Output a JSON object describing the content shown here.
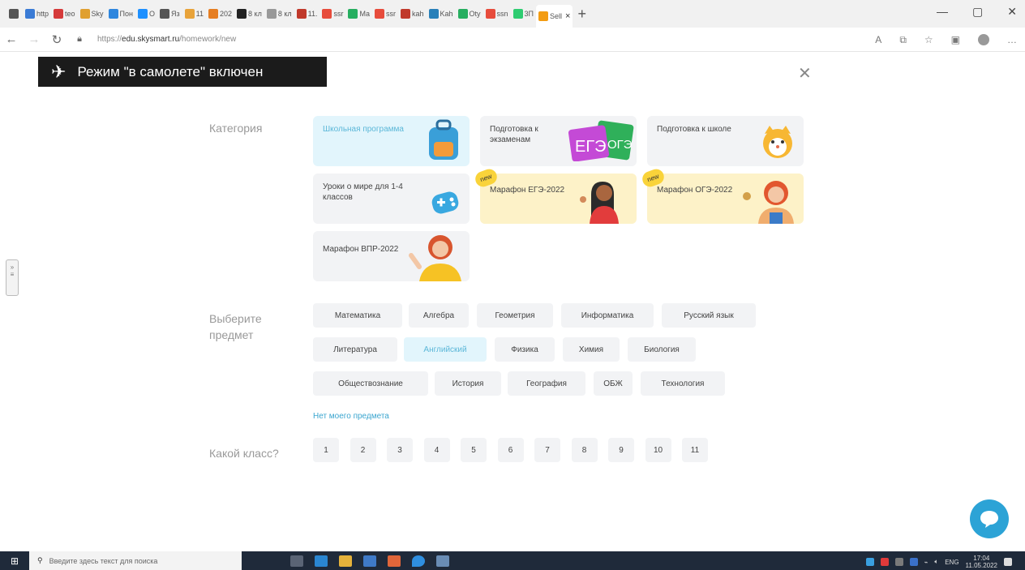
{
  "browser": {
    "tabs": [
      "http",
      "teo",
      "Sky",
      "Пон",
      "О",
      "Яз",
      "11",
      "202",
      "8 кл",
      "8 кл",
      "11.",
      "ssr",
      "Ma",
      "ssr",
      "kah",
      "Kah",
      "Oty",
      "ssn",
      "3П",
      "Sell"
    ],
    "url_prefix": "https://",
    "url_domain": "edu.skysmart.ru",
    "url_path": "/homework/new"
  },
  "toast": {
    "text": "Режим \"в самолете\" включен"
  },
  "categories": {
    "label": "Категория",
    "items": [
      {
        "label": "Школьная программа",
        "new_badge": ""
      },
      {
        "label": "Подготовка к экзаменам",
        "new_badge": "",
        "art_text1": "ЕГЭ",
        "art_text2": "ОГЭ"
      },
      {
        "label": "Подготовка к школе",
        "new_badge": ""
      },
      {
        "label": "Уроки о мире для 1-4 классов",
        "new_badge": ""
      },
      {
        "label": "Марафон ЕГЭ-2022",
        "new_badge": "new"
      },
      {
        "label": "Марафон ОГЭ-2022",
        "new_badge": "new"
      },
      {
        "label": "Марафон ВПР-2022",
        "new_badge": ""
      }
    ]
  },
  "subjects": {
    "label": "Выберите предмет",
    "items": [
      "Математика",
      "Алгебра",
      "Геометрия",
      "Информатика",
      "Русский язык",
      "Литература",
      "Английский",
      "Физика",
      "Химия",
      "Биология",
      "Обществознание",
      "История",
      "География",
      "ОБЖ",
      "Технология"
    ],
    "no_subject_link": "Нет моего предмета"
  },
  "grades": {
    "label": "Какой класс?",
    "items": [
      "1",
      "2",
      "3",
      "4",
      "5",
      "6",
      "7",
      "8",
      "9",
      "10",
      "11"
    ]
  },
  "taskbar": {
    "search_placeholder": "Введите здесь текст для поиска",
    "lang": "ENG",
    "time": "17:04",
    "date": "11.05.2022"
  },
  "colors": {
    "accent": "#2ca3d6",
    "selected_bg": "#e2f5fc",
    "selected_text": "#5bb7d8",
    "card_bg": "#f2f3f5",
    "yellow_card": "#fdf2c8"
  }
}
